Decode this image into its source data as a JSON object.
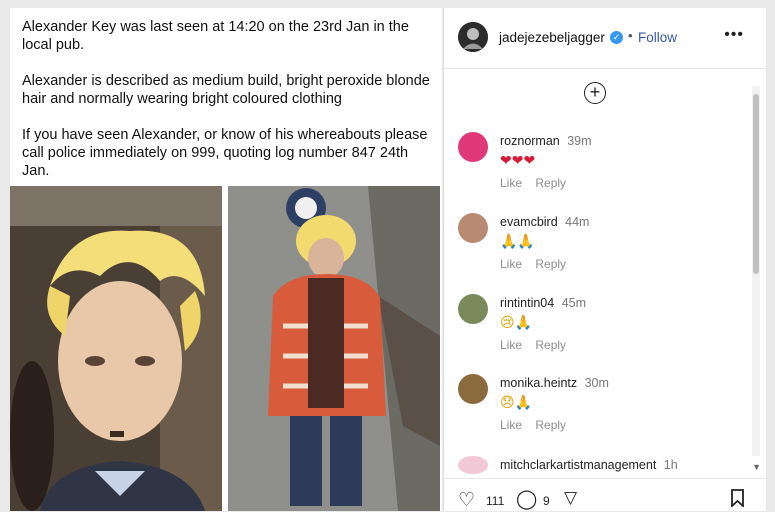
{
  "notice": {
    "line1": "Alexander Key was last seen at 14:20 on the 23rd Jan in the local pub.",
    "line2": "Alexander is described as medium build, bright peroxide blonde hair and normally wearing bright coloured clothing",
    "line3": "If you have seen Alexander, or know of his whereabouts please call police immediately on 999, quoting log number 847 24th Jan."
  },
  "header": {
    "username": "jadejezebeljagger",
    "separator": "•",
    "follow_label": "Follow",
    "more_label": "•••"
  },
  "add_comment_label": "+",
  "comments": [
    {
      "username": "roznorman",
      "time": "39m",
      "emoji": "❤❤❤",
      "like_label": "Like",
      "reply_label": "Reply",
      "avatar_color": "#e0397a"
    },
    {
      "username": "evamcbird",
      "time": "44m",
      "emoji": "🙏🙏",
      "like_label": "Like",
      "reply_label": "Reply",
      "avatar_color": "#b88a74"
    },
    {
      "username": "rintintin04",
      "time": "45m",
      "emoji": "😢🙏",
      "like_label": "Like",
      "reply_label": "Reply",
      "avatar_color": "#7a8a5a"
    },
    {
      "username": "monika.heintz",
      "time": "30m",
      "emoji": "😞🙏",
      "like_label": "Like",
      "reply_label": "Reply",
      "avatar_color": "#8b6a3e"
    },
    {
      "username": "mitchclarkartistmanagement",
      "time": "1h",
      "emoji": "",
      "like_label": "",
      "reply_label": "",
      "avatar_color": "#f3c8d6"
    }
  ],
  "footer": {
    "likes": "111",
    "comments": "9",
    "like_icon": "heart-icon",
    "comment_icon": "comment-bubble-icon",
    "share_icon": "share-send-icon",
    "save_icon": "bookmark-icon"
  },
  "colors": {
    "follow": "#3757a8",
    "verified": "#3897f0",
    "hearts": "#d81b3a"
  }
}
